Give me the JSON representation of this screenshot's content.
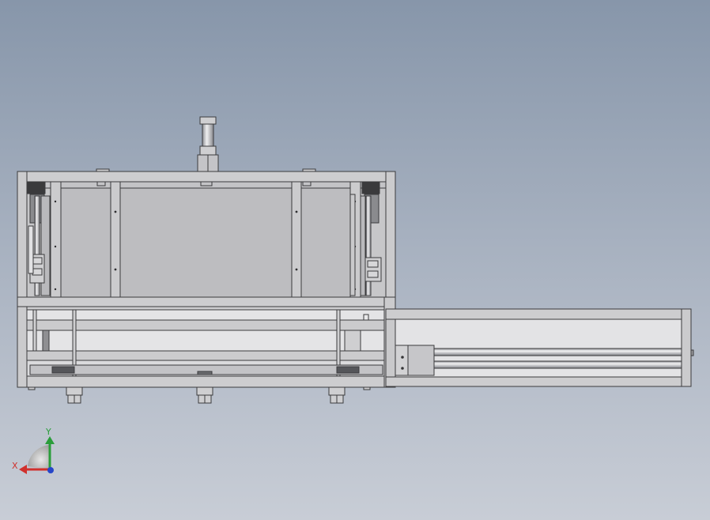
{
  "viewport": {
    "background_top": "#8796aa",
    "background_bottom": "#c8cdd6",
    "view": "front"
  },
  "model": {
    "frame_color": "#c9c9cb",
    "frame_outline": "#3b3b3d",
    "panel_color": "#bfbfc2",
    "rod_color": "#d8d8da"
  },
  "triad": {
    "x_label": "X",
    "y_label": "Y",
    "x_color": "#d0312d",
    "y_color": "#2a9d3a",
    "z_color": "#2646c8"
  }
}
